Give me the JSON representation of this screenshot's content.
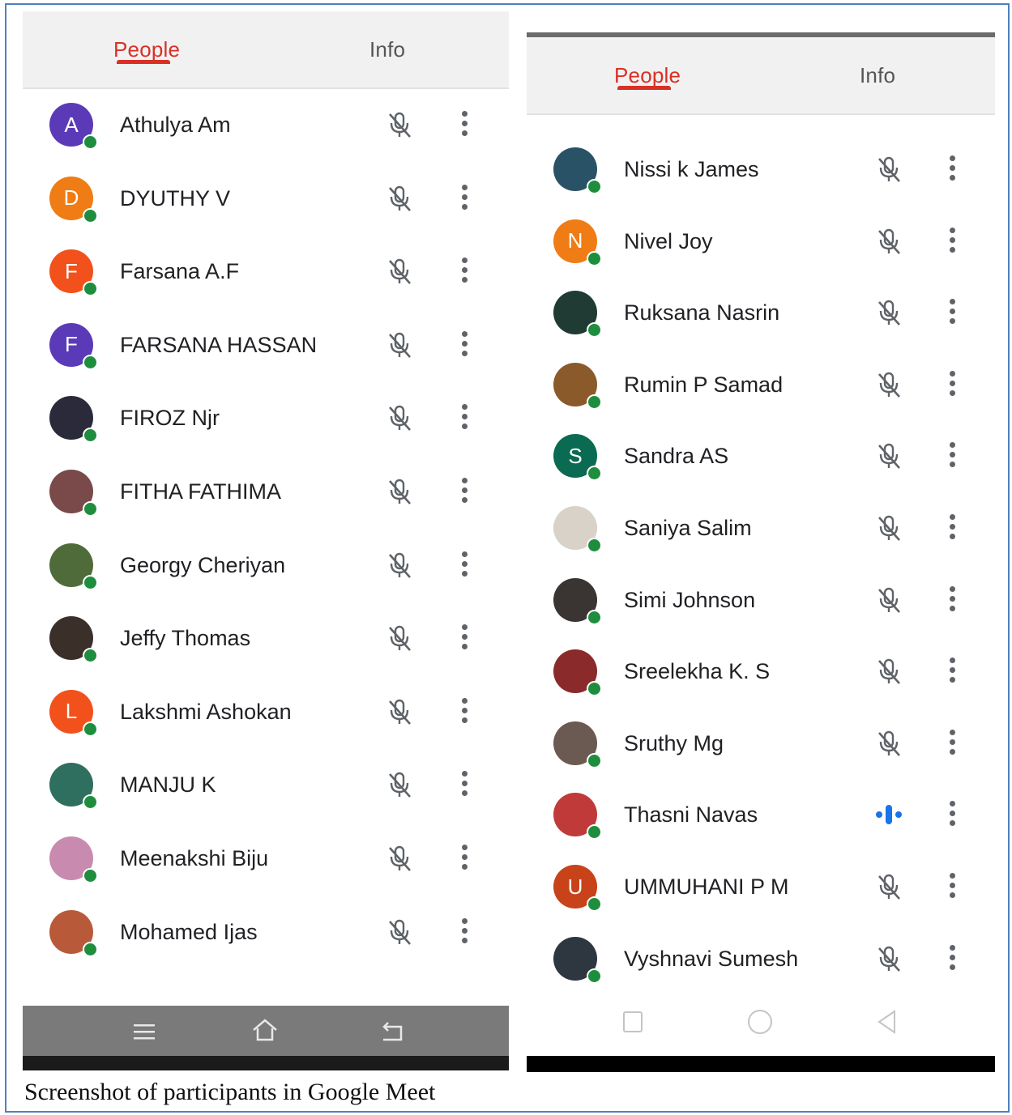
{
  "tabs": {
    "people": "People",
    "info": "Info"
  },
  "colors": {
    "accent": "#d93025",
    "presence": "#1e8e3e",
    "speaking": "#1a73e8",
    "mic_muted": "#5f6368"
  },
  "panels": [
    {
      "participants": [
        {
          "name": "Athulya Am",
          "initial": "A",
          "avatar_color": "#5b3ab8",
          "mic": "muted"
        },
        {
          "name": "DYUTHY V",
          "initial": "D",
          "avatar_color": "#ef7c14",
          "mic": "muted"
        },
        {
          "name": "Farsana A.F",
          "initial": "F",
          "avatar_color": "#f2511b",
          "mic": "muted"
        },
        {
          "name": "FARSANA HASSAN",
          "initial": "F",
          "avatar_color": "#5b3ab8",
          "mic": "muted"
        },
        {
          "name": "FIROZ Njr",
          "initial": "",
          "avatar_color": "#2a2a3a",
          "mic": "muted"
        },
        {
          "name": "FITHA FATHIMA",
          "initial": "",
          "avatar_color": "#7a4a4a",
          "mic": "muted"
        },
        {
          "name": "Georgy Cheriyan",
          "initial": "",
          "avatar_color": "#4f6b3a",
          "mic": "muted"
        },
        {
          "name": "Jeffy Thomas",
          "initial": "",
          "avatar_color": "#3b2f2a",
          "mic": "muted"
        },
        {
          "name": "Lakshmi Ashokan",
          "initial": "L",
          "avatar_color": "#f2511b",
          "mic": "muted"
        },
        {
          "name": "MANJU K",
          "initial": "",
          "avatar_color": "#2f6f5f",
          "mic": "muted"
        },
        {
          "name": "Meenakshi Biju",
          "initial": "",
          "avatar_color": "#c98ab0",
          "mic": "muted"
        },
        {
          "name": "Mohamed Ijas",
          "initial": "",
          "avatar_color": "#b85a3a",
          "mic": "muted"
        }
      ]
    },
    {
      "participants": [
        {
          "name": "Nissi k James",
          "initial": "",
          "avatar_color": "#2a5266",
          "mic": "muted"
        },
        {
          "name": "Nivel Joy",
          "initial": "N",
          "avatar_color": "#ef7c14",
          "mic": "muted"
        },
        {
          "name": "Ruksana Nasrin",
          "initial": "",
          "avatar_color": "#1f3b33",
          "mic": "muted"
        },
        {
          "name": "Rumin P Samad",
          "initial": "",
          "avatar_color": "#8a5a2a",
          "mic": "muted"
        },
        {
          "name": "Sandra AS",
          "initial": "S",
          "avatar_color": "#0b6b52",
          "mic": "muted"
        },
        {
          "name": "Saniya Salim",
          "initial": "",
          "avatar_color": "#d8d2c8",
          "mic": "muted"
        },
        {
          "name": "Simi Johnson",
          "initial": "",
          "avatar_color": "#3a3532",
          "mic": "muted"
        },
        {
          "name": "Sreelekha K. S",
          "initial": "",
          "avatar_color": "#8a2a2a",
          "mic": "muted"
        },
        {
          "name": "Sruthy Mg",
          "initial": "",
          "avatar_color": "#6a5a52",
          "mic": "muted"
        },
        {
          "name": "Thasni Navas",
          "initial": "",
          "avatar_color": "#c03a3a",
          "mic": "speaking"
        },
        {
          "name": "UMMUHANI P M",
          "initial": "U",
          "avatar_color": "#c8421a",
          "mic": "muted"
        },
        {
          "name": "Vyshnavi Sumesh",
          "initial": "",
          "avatar_color": "#2e3640",
          "mic": "muted"
        }
      ]
    }
  ],
  "caption": "Screenshot of participants in Google Meet"
}
